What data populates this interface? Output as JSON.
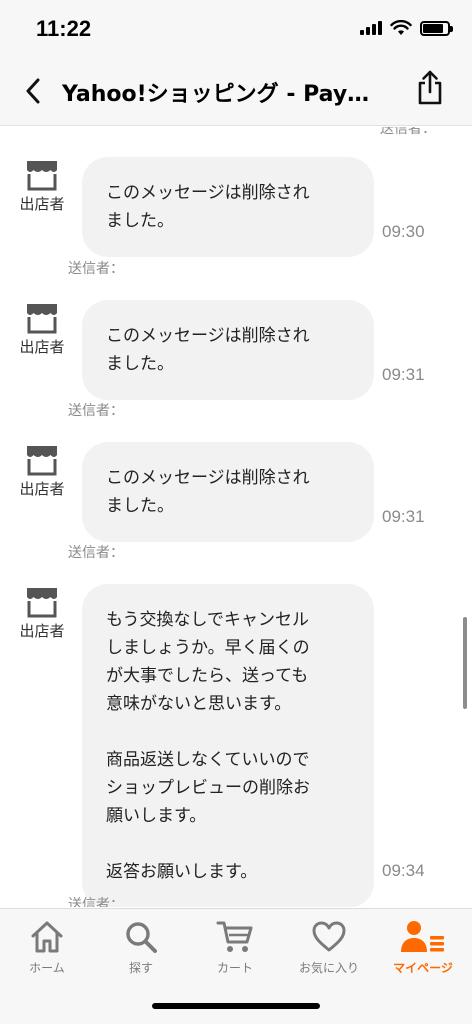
{
  "status_bar": {
    "time": "11:22"
  },
  "header": {
    "title": "Yahoo!ショッピング - Pay…"
  },
  "chat": {
    "top_partial_label": "送信者：",
    "messages": [
      {
        "shop_name": "出店者",
        "text": "このメッセージは削除され\nました。",
        "time": "09:30",
        "sender_label": "送信者："
      },
      {
        "shop_name": "出店者",
        "text": "このメッセージは削除され\nました。",
        "time": "09:31",
        "sender_label": "送信者："
      },
      {
        "shop_name": "出店者",
        "text": "このメッセージは削除され\nました。",
        "time": "09:31",
        "sender_label": "送信者："
      },
      {
        "shop_name": "出店者",
        "text": "もう交換なしでキャンセル\nしましょうか。早く届くの\nが大事でしたら、送っても\n意味がないと思います。\n\n商品返送しなくていいので\nショップレビューの削除お\n願いします。\n\n返答お願いします。",
        "time": "09:34",
        "sender_label": "送信者："
      }
    ]
  },
  "tab_bar": {
    "active_color": "#ff6a00",
    "inactive_color": "#7a7a7a",
    "tabs": [
      {
        "label": "ホーム",
        "icon": "home-icon"
      },
      {
        "label": "探す",
        "icon": "search-icon"
      },
      {
        "label": "カート",
        "icon": "cart-icon"
      },
      {
        "label": "お気に入り",
        "icon": "heart-icon"
      },
      {
        "label": "マイページ",
        "icon": "mypage-icon",
        "active": true
      }
    ]
  }
}
